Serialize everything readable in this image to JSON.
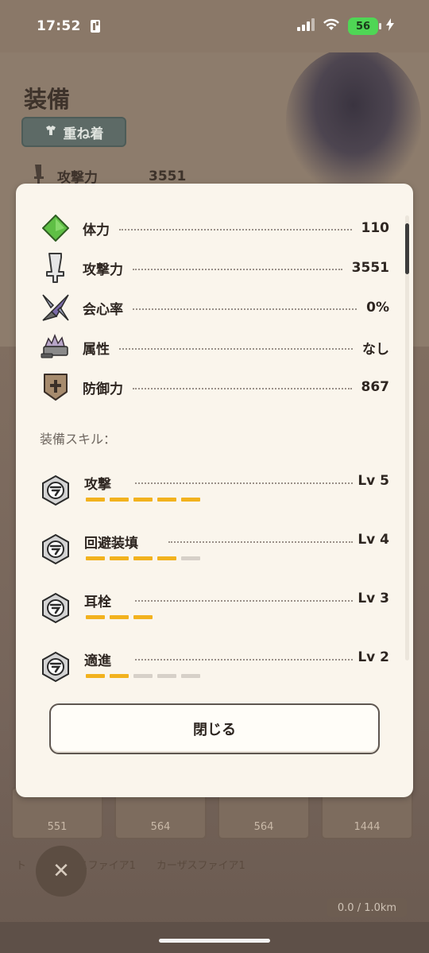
{
  "status_bar": {
    "time": "17:52",
    "battery": "56"
  },
  "background": {
    "title": "装備",
    "overlay_button": "重ね着",
    "stat_label": "攻撃力",
    "stat_value": "3551",
    "cards": [
      "551",
      "564",
      "564",
      "1444"
    ],
    "names": [
      "ト",
      "レックスファイア1",
      "カーザスファイア1"
    ],
    "distance": "0.0 / 1.0km"
  },
  "modal": {
    "stats": [
      {
        "icon": "stamina-icon",
        "label": "体力",
        "value": "110"
      },
      {
        "icon": "attack-sword-icon",
        "label": "攻撃力",
        "value": "3551"
      },
      {
        "icon": "affinity-icon",
        "label": "会心率",
        "value": "0%"
      },
      {
        "icon": "element-icon",
        "label": "属性",
        "value": "なし"
      },
      {
        "icon": "defense-shield-icon",
        "label": "防御力",
        "value": "867"
      }
    ],
    "skills_label": "装備スキル：",
    "skills": [
      {
        "name": "攻撃",
        "level": "Lv 5",
        "filled": 5,
        "total": 5
      },
      {
        "name": "回避装填",
        "level": "Lv 4",
        "filled": 4,
        "total": 5
      },
      {
        "name": "耳栓",
        "level": "Lv 3",
        "filled": 3,
        "total": 3
      },
      {
        "name": "適進",
        "level": "Lv 2",
        "filled": 2,
        "total": 5
      }
    ],
    "close_button": "閉じる"
  },
  "colors": {
    "accent_yellow": "#f2b21e",
    "segment_empty": "#d6d0c8",
    "modal_bg": "#faf5ec"
  }
}
